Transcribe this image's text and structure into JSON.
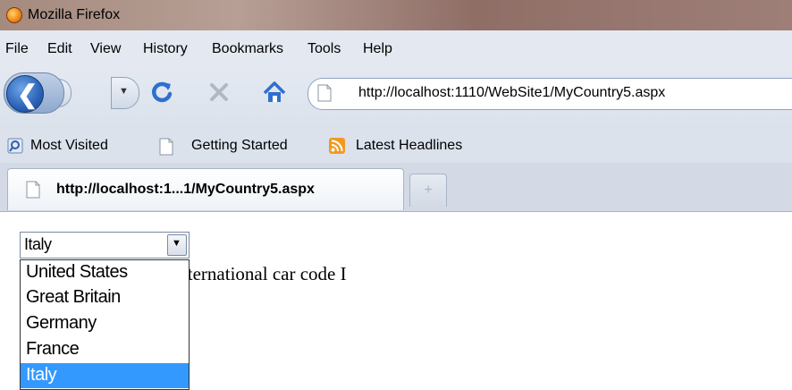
{
  "window": {
    "title": "Mozilla Firefox"
  },
  "menu": [
    "File",
    "Edit",
    "View",
    "History",
    "Bookmarks",
    "Tools",
    "Help"
  ],
  "navigation": {
    "back_icon": "back-arrow-icon",
    "forward_icon": "forward-arrow-icon",
    "url": "http://localhost:1110/WebSite1/MyCountry5.aspx"
  },
  "bookmarks": [
    "Most Visited",
    "Getting Started",
    "Latest Headlines"
  ],
  "tab": {
    "title": "http://localhost:1...1/MyCountry5.aspx",
    "new_tab": "+"
  },
  "page": {
    "select_value": "Italy",
    "options": [
      "United States",
      "Great Britain",
      "Germany",
      "France",
      "Italy"
    ],
    "selected_index": 4,
    "sentence": "The country has the international car code I"
  },
  "colors": {
    "selection": "#3399ff",
    "accent": "#2f6fd0"
  }
}
